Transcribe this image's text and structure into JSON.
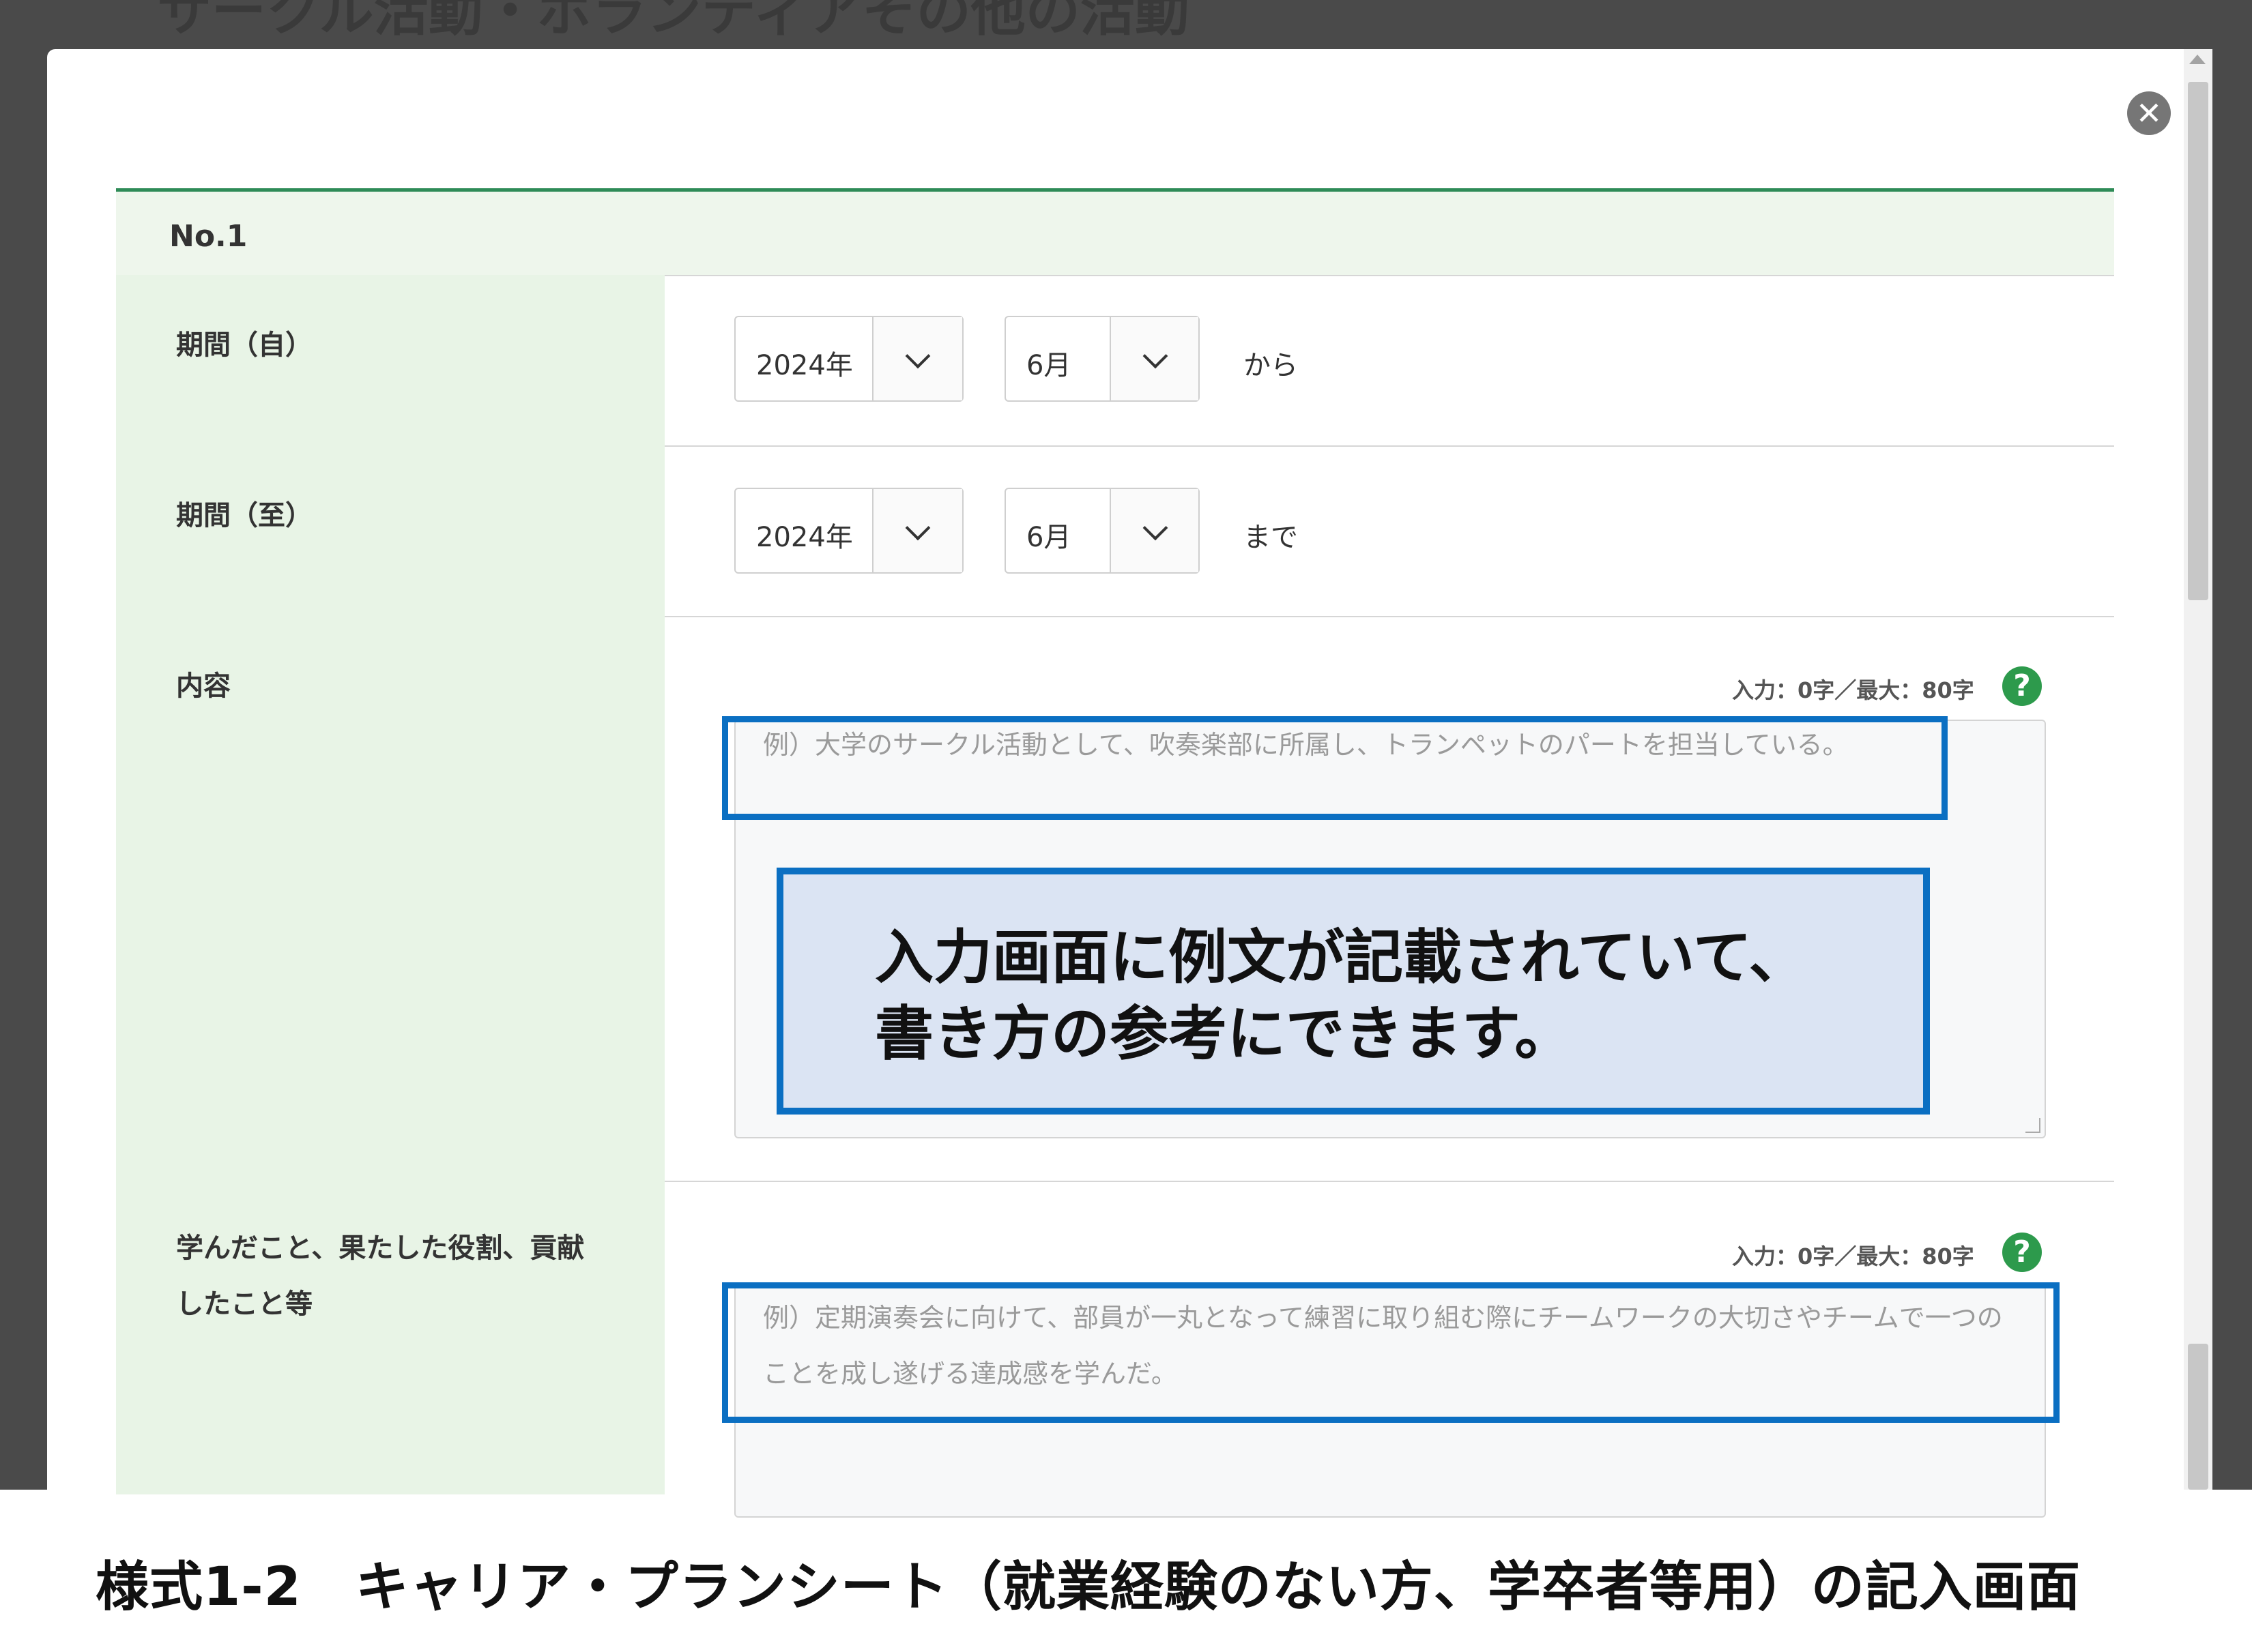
{
  "header": {
    "partial_heading": "サークル活動・ボランティアその他の活動"
  },
  "form": {
    "entry_label": "No.1",
    "period_from": {
      "label": "期間（自）",
      "year": "2024年",
      "month": "6月",
      "suffix": "から"
    },
    "period_to": {
      "label": "期間（至）",
      "year": "2024年",
      "month": "6月",
      "suffix": "まで"
    },
    "content": {
      "label": "内容",
      "counter": "入力：0字／最大：80字",
      "help": "?",
      "placeholder": "例）大学のサークル活動として、吹奏楽部に所属し、トランペットのパートを担当している。"
    },
    "learned": {
      "label": "学んだこと、果たした役割、貢献したこと等",
      "counter": "入力：0字／最大：80字",
      "help": "?",
      "placeholder": "例）定期演奏会に向けて、部員が一丸となって練習に取り組む際にチームワークの大切さやチームで一つのことを成し遂げる達成感を学んだ。"
    }
  },
  "callout": "入力画面に例文が記載されていて、\n書き方の参考にできます。",
  "caption": "様式1-2　キャリア・プランシート（就業経験のない方、学卒者等用）の記入画面",
  "colors": {
    "accent_green": "#2e8b57",
    "label_bg": "#e8f4e6",
    "highlight_blue": "#0b6fc2"
  }
}
